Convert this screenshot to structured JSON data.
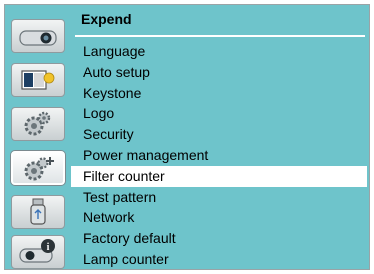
{
  "menu": {
    "title": "Expend",
    "items": [
      {
        "label": "Language"
      },
      {
        "label": "Auto setup"
      },
      {
        "label": "Keystone"
      },
      {
        "label": "Logo"
      },
      {
        "label": "Security"
      },
      {
        "label": "Power management"
      },
      {
        "label": "Filter counter"
      },
      {
        "label": "Test pattern"
      },
      {
        "label": "Network"
      },
      {
        "label": "Factory default"
      },
      {
        "label": "Lamp counter"
      }
    ],
    "selected_index": 6
  },
  "sidebar": {
    "icons": [
      "projector-input-icon",
      "picture-adjust-icon",
      "settings-gears-icon",
      "expand-gears-icon",
      "usb-memory-icon",
      "info-projector-icon"
    ],
    "active_index": 3
  },
  "colors": {
    "background": "#6ec4cb",
    "highlight": "#ffffff"
  }
}
